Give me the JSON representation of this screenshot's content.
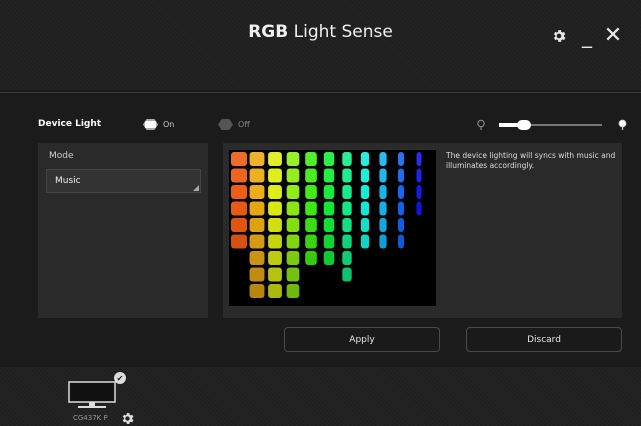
{
  "window": {
    "title_bold": "RGB",
    "title_rest": " Light Sense",
    "icons": {
      "settings": "gear-icon",
      "minimize": "minimize-icon",
      "close": "close-icon"
    },
    "minimize_glyph": "_",
    "close_glyph": "✕"
  },
  "device_light": {
    "label": "Device Light",
    "on_label": "On",
    "off_label": "Off",
    "selected": "On",
    "brightness_level": 0.2
  },
  "mode": {
    "label": "Mode",
    "selected": "Music"
  },
  "preview": {
    "description": "The device lighting will syncs with music and illuminates accordingly."
  },
  "actions": {
    "apply_label": "Apply",
    "discard_label": "Discard"
  },
  "devices": [
    {
      "name": "CG437K P",
      "checked": true
    }
  ],
  "colors": {
    "accent": "#ffffff",
    "background": "#1a1a1a",
    "panel": "#2a2a2a"
  }
}
